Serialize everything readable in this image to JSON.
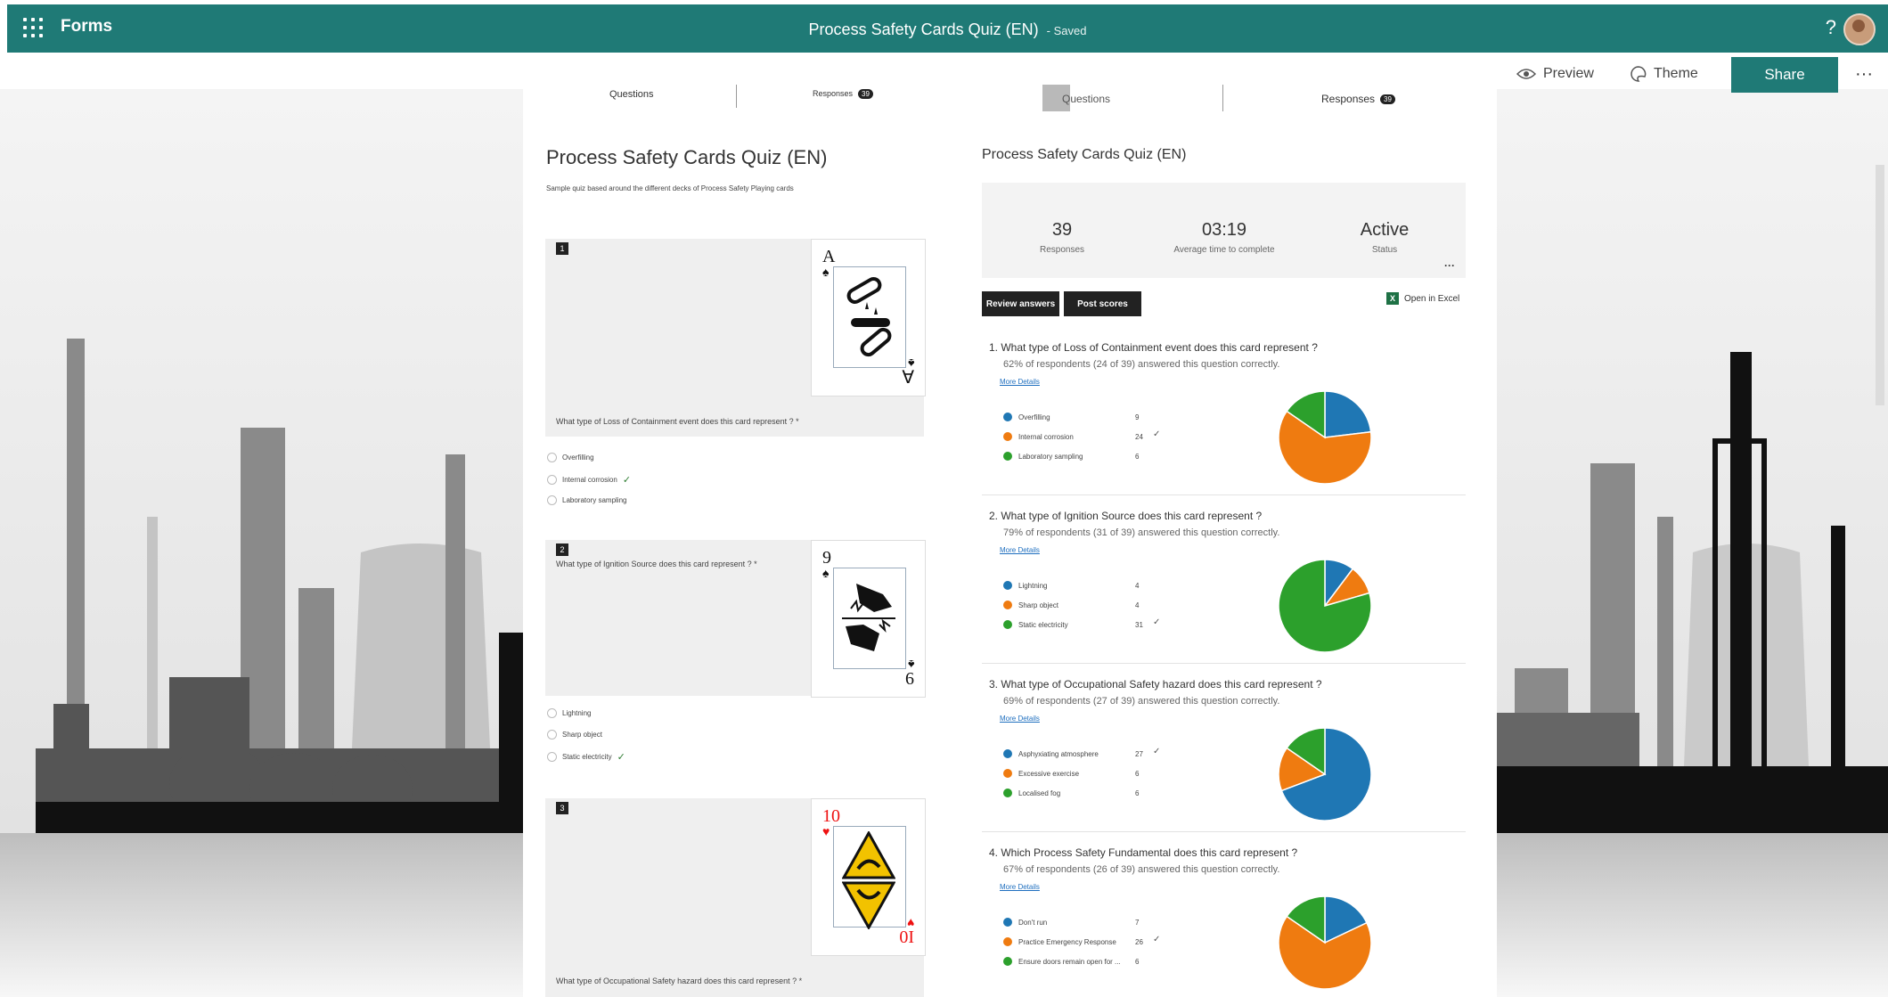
{
  "app": {
    "brand": "Forms",
    "doc_title": "Process Safety Cards Quiz (EN)",
    "doc_status": "- Saved",
    "help": "?"
  },
  "commands": {
    "preview": "Preview",
    "theme": "Theme",
    "share": "Share",
    "more": "···"
  },
  "left": {
    "tabs": {
      "questions": "Questions",
      "responses": "Responses",
      "responses_count": "39"
    },
    "title": "Process Safety Cards Quiz (EN)",
    "description": "Sample quiz based around the different decks of Process Safety Playing cards",
    "questions": [
      {
        "number": "1",
        "text": "What type of Loss of Containment event does this card represent ? *",
        "card": {
          "rank": "A",
          "suit": "♠",
          "rank_rot": "∀",
          "color": "#111"
        },
        "options": [
          "Overfilling",
          "Internal corrosion",
          "Laboratory sampling"
        ],
        "correct_index": 1
      },
      {
        "number": "2",
        "text": "What type of Ignition Source does this card represent ? *",
        "card": {
          "rank": "9",
          "suit": "♠",
          "rank_rot": "6",
          "color": "#111"
        },
        "options": [
          "Lightning",
          "Sharp object",
          "Static electricity"
        ],
        "correct_index": 2
      },
      {
        "number": "3",
        "text": "What type of Occupational Safety hazard does this card represent ? *",
        "card": {
          "rank": "10",
          "suit": "♥",
          "rank_rot": "0I",
          "color": "#e11"
        },
        "options": [],
        "correct_index": -1
      }
    ]
  },
  "right": {
    "tabs": {
      "questions": "Questions",
      "responses": "Responses",
      "responses_count": "39"
    },
    "title": "Process Safety Cards Quiz (EN)",
    "stats": [
      {
        "value": "39",
        "label": "Responses"
      },
      {
        "value": "03:19",
        "label": "Average time to complete"
      },
      {
        "value": "Active",
        "label": "Status"
      }
    ],
    "stats_more": "···",
    "review_answers": "Review answers",
    "post_scores": "Post scores",
    "open_in_excel": "Open in Excel",
    "excel_icon": "X",
    "more_details": "More Details",
    "questions": [
      {
        "title": "1.  What type of Loss of Containment event does this card represent ?",
        "summary": "62% of respondents (24 of 39) answered this question correctly.",
        "options": [
          {
            "label": "Overfilling",
            "count": "9",
            "correct": false
          },
          {
            "label": "Internal corrosion",
            "count": "24",
            "correct": true
          },
          {
            "label": "Laboratory sampling",
            "count": "6",
            "correct": false
          }
        ]
      },
      {
        "title": "2.  What type of Ignition Source does this card represent ?",
        "summary": "79% of respondents (31 of 39) answered this question correctly.",
        "options": [
          {
            "label": "Lightning",
            "count": "4",
            "correct": false
          },
          {
            "label": "Sharp object",
            "count": "4",
            "correct": false
          },
          {
            "label": "Static electricity",
            "count": "31",
            "correct": true
          }
        ]
      },
      {
        "title": "3.  What type of Occupational Safety hazard does this card represent ?",
        "summary": "69% of respondents (27 of 39) answered this question correctly.",
        "options": [
          {
            "label": "Asphyxiating atmosphere",
            "count": "27",
            "correct": true
          },
          {
            "label": "Excessive exercise",
            "count": "6",
            "correct": false
          },
          {
            "label": "Localised fog",
            "count": "6",
            "correct": false
          }
        ]
      },
      {
        "title": "4.  Which Process Safety Fundamental does this card represent ?",
        "summary": "67% of respondents (26 of 39) answered this question correctly.",
        "options": [
          {
            "label": "Don't run",
            "count": "7",
            "correct": false
          },
          {
            "label": "Practice Emergency Response",
            "count": "26",
            "correct": true
          },
          {
            "label": "Ensure doors remain open for ...",
            "count": "6",
            "correct": false
          }
        ]
      }
    ]
  },
  "colors": {
    "teal": "#1f7a76",
    "blue": "#1f77b4",
    "orange": "#ef7b10",
    "green": "#2ca02c"
  },
  "icons": [
    "waffle-icon",
    "help-icon",
    "eye-icon",
    "palette-icon",
    "checkmark-icon",
    "excel-icon"
  ]
}
